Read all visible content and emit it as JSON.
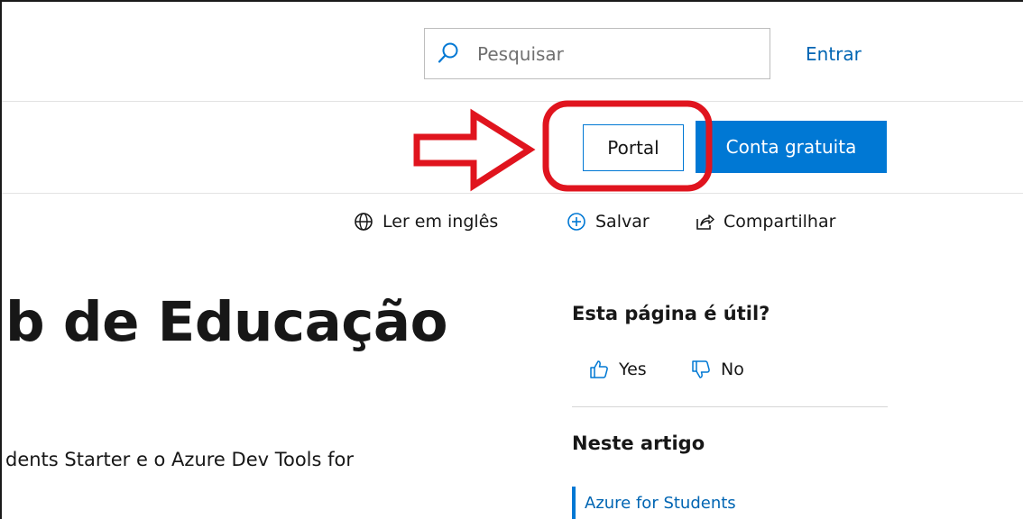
{
  "header": {
    "search": {
      "placeholder": "Pesquisar",
      "value": ""
    },
    "sign_in_label": "Entrar"
  },
  "nav": {
    "portal_label": "Portal",
    "free_account_label": "Conta gratuita"
  },
  "actions": [
    {
      "icon": "globe-icon",
      "label": "Ler em inglês"
    },
    {
      "icon": "plus-circle-icon",
      "label": "Salvar"
    },
    {
      "icon": "share-icon",
      "label": "Compartilhar"
    }
  ],
  "article": {
    "title": "b de Educação",
    "text": "dents Starter e o Azure Dev Tools for"
  },
  "sidebar": {
    "feedback": {
      "question": "Esta página é útil?",
      "yes_label": "Yes",
      "no_label": "No"
    },
    "toc": {
      "heading": "Neste artigo",
      "items": [
        "Azure for Students"
      ]
    }
  },
  "colors": {
    "accent": "#0078d4",
    "link": "#0065b3",
    "annotation": "#e0141e"
  }
}
